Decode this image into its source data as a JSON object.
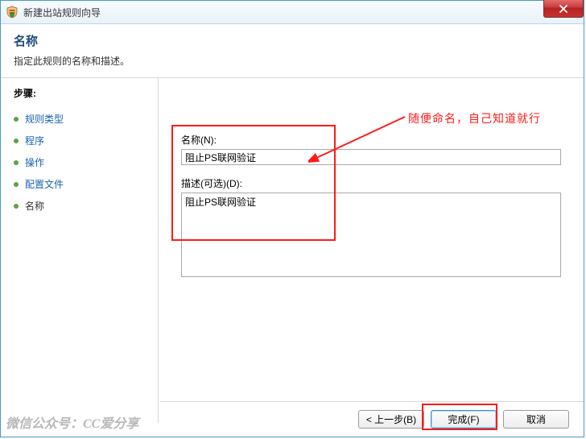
{
  "titlebar": {
    "title": "新建出站规则向导"
  },
  "header": {
    "title": "名称",
    "subtitle": "指定此规则的名称和描述。"
  },
  "sidebar": {
    "label": "步骤:",
    "items": [
      {
        "label": "规则类型",
        "current": false
      },
      {
        "label": "程序",
        "current": false
      },
      {
        "label": "操作",
        "current": false
      },
      {
        "label": "配置文件",
        "current": false
      },
      {
        "label": "名称",
        "current": true
      }
    ]
  },
  "form": {
    "name_label": "名称(N):",
    "name_value": "阻止PS联网验证",
    "desc_label": "描述(可选)(D):",
    "desc_value": "阻止PS联网验证"
  },
  "annotation": {
    "text": "随便命名，自己知道就行"
  },
  "footer": {
    "back": "< 上一步(B)",
    "finish": "完成(F)",
    "cancel": "取消"
  },
  "watermark": "微信公众号：CC爱分享"
}
